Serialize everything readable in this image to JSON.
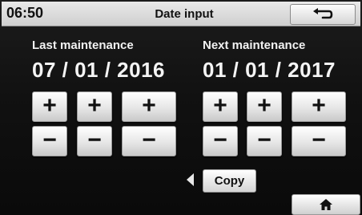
{
  "header": {
    "time": "06:50",
    "title": "Date input",
    "back_icon": "return-arrow-icon"
  },
  "last_maintenance": {
    "label": "Last maintenance",
    "date": "07 / 01 / 2016"
  },
  "next_maintenance": {
    "label": "Next maintenance",
    "date": "01 / 01 / 2017"
  },
  "controls": {
    "plus": "+",
    "minus": "−"
  },
  "copy": {
    "label": "Copy",
    "icon": "left-triangle-icon"
  },
  "home": {
    "icon": "home-icon"
  }
}
